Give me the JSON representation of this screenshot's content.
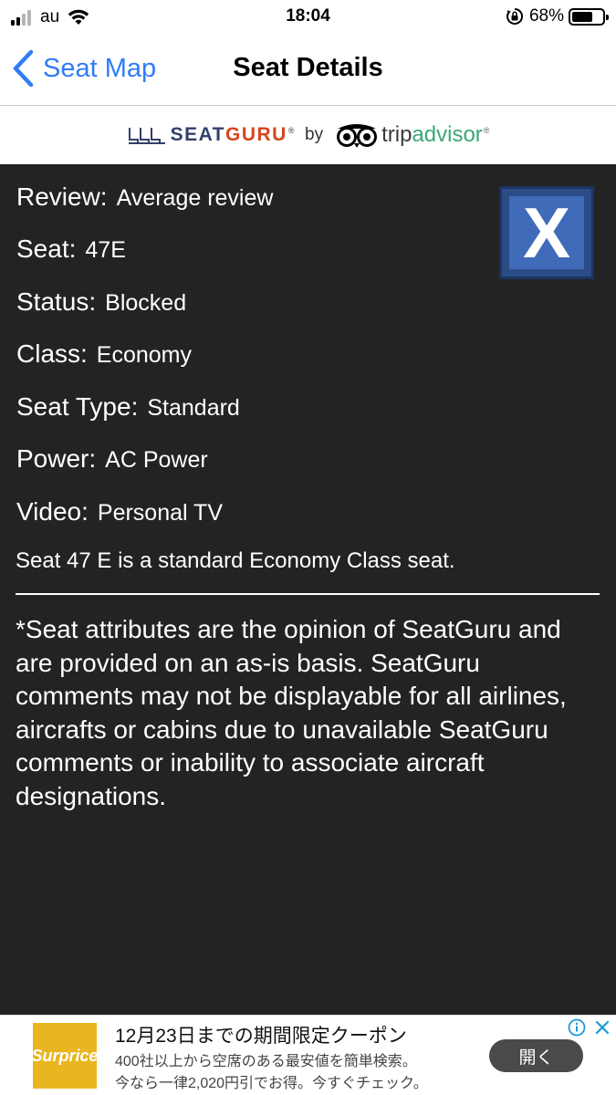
{
  "status_bar": {
    "carrier": "au",
    "time": "18:04",
    "battery_percent": "68%",
    "battery_level": 0.68,
    "icons": [
      "signal-icon",
      "wifi-icon",
      "rotation-lock-icon",
      "battery-icon"
    ]
  },
  "nav": {
    "back_label": "Seat Map",
    "title": "Seat Details"
  },
  "brand": {
    "seatguru_prefix": "SEAT",
    "seatguru_suffix": "GURU",
    "registered": "®",
    "by": "by",
    "tripadvisor_prefix": "trip",
    "tripadvisor_suffix": "advisor",
    "tripadvisor_registered": "®",
    "colors": {
      "seatguru": "#33406a",
      "seatguru_accent": "#d6461e",
      "tripadvisor_accent": "#39a974"
    }
  },
  "details": {
    "review_label": "Review:",
    "review_value": "Average review",
    "seat_label": "Seat:",
    "seat_value": "47E",
    "status_label": "Status:",
    "status_value": "Blocked",
    "class_label": "Class:",
    "class_value": "Economy",
    "seat_type_label": "Seat Type:",
    "seat_type_value": "Standard",
    "power_label": "Power:",
    "power_value": "AC Power",
    "video_label": "Video:",
    "video_value": "Personal TV",
    "description": "Seat 47 E is a standard Economy Class seat.",
    "status_badge": "X",
    "badge_color": "#3f6bb8"
  },
  "disclaimer": "*Seat attributes are the opinion of SeatGuru and are provided on an as-is basis. SeatGuru comments may not be displayable for all airlines, aircrafts or cabins due to unavailable SeatGuru comments or inability to associate aircraft designations.",
  "ad": {
    "logo_text": "Surprice",
    "title": "12月23日までの期間限定クーポン",
    "line1": "400社以上から空席のある最安値を簡単検索。",
    "line2": "今なら一律2,020円引でお得。今すぐチェック。",
    "button": "開く"
  },
  "colors": {
    "accent": "#2f7cf6",
    "content_background": "#232323"
  }
}
